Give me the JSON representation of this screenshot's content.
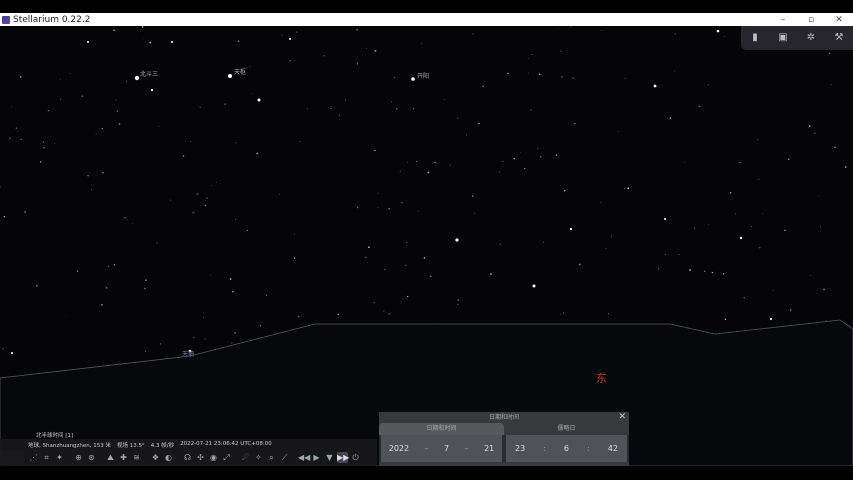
{
  "window": {
    "title": "Stellarium 0.22.2",
    "controls": [
      "–",
      "▫",
      "✕"
    ]
  },
  "sky": {
    "labels": [
      {
        "id": "star-a",
        "text": "北斗三"
      },
      {
        "id": "star-b",
        "text": "天枢"
      },
      {
        "id": "star-c",
        "text": "开阳"
      },
      {
        "id": "star-d",
        "text": "天鹅"
      }
    ],
    "compass_east": "东"
  },
  "topbar": {
    "icons": [
      "trash-icon",
      "window-icon",
      "gear-icon",
      "wrench-icon"
    ]
  },
  "bottombar": {
    "left_label": "北半球时间 [1]",
    "status": {
      "location": "地球, Shanzhuangzhen, 153 米",
      "fov": "视场 13.5°",
      "fps": "4.3 帧/秒",
      "datetime": "2022-07-21 23:06:42 UTC+08:00"
    }
  },
  "datetime_panel": {
    "title": "日期和时间",
    "tabs": [
      "日期和时间",
      "儒略日"
    ],
    "date": {
      "year": "2022",
      "month": "7",
      "day": "21"
    },
    "time": {
      "hour": "23",
      "minute": "6",
      "second": "42"
    }
  },
  "colors": {
    "sky": "#050508",
    "ground": "#07080b",
    "horizon_line": "#50586a",
    "accent_east": "#c0392b"
  }
}
